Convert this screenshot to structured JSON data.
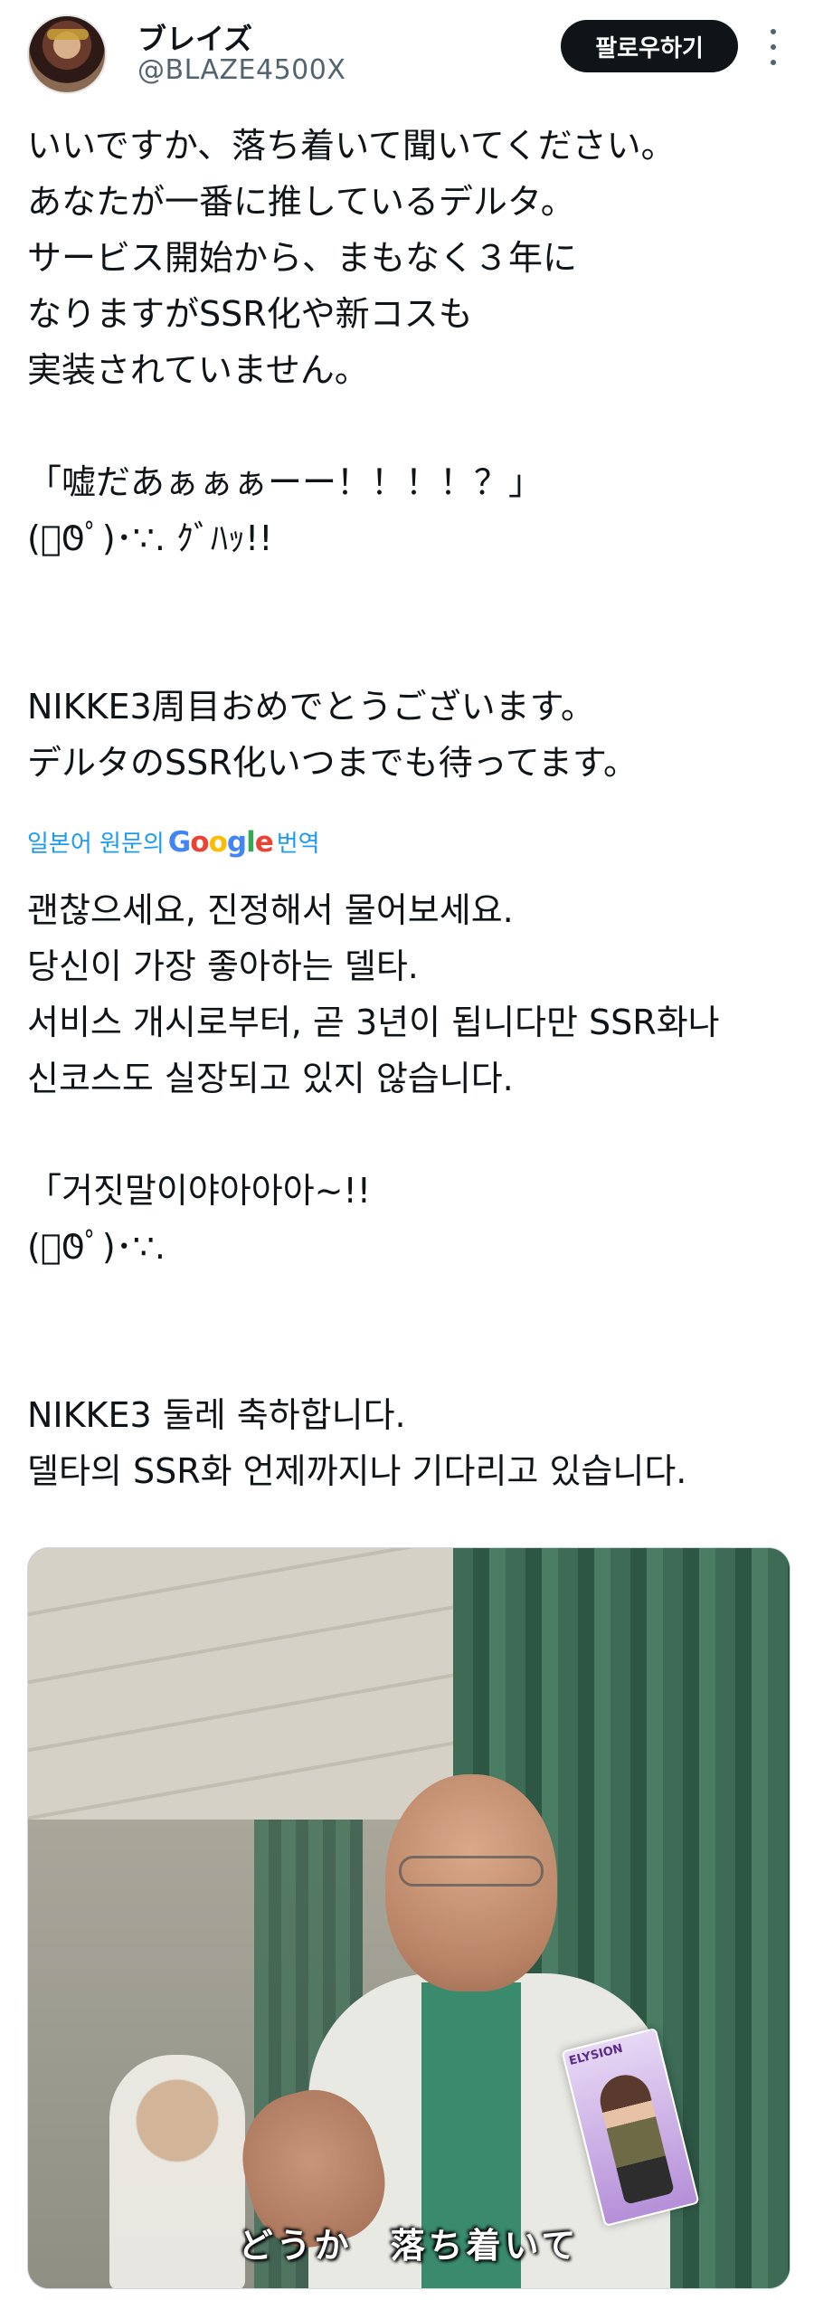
{
  "header": {
    "display_name": "ブレイズ",
    "handle": "@BLAZE4500X",
    "follow_label": "팔로우하기",
    "more_icon": "more-vertical-icon"
  },
  "tweet": {
    "lines": [
      "いいですか、落ち着いて聞いてください。",
      "あなたが一番に推しているデルタ。",
      "サービス開始から、まもなく３年に",
      "なりますがSSR化や新コスも",
      "実装されていません。",
      "",
      "「嘘だあぁぁぁーー！！！！？」",
      " (ﾟ𐐃ﾟ)･∵. ｸﾞﾊｯ!!",
      "",
      "",
      "NIKKE3周目おめでとうございます。",
      "デルタのSSR化いつまでも待ってます。"
    ]
  },
  "translate": {
    "prefix": "일본어 원문의",
    "brand": "Google",
    "suffix": "번역"
  },
  "translation": {
    "lines": [
      "괜찮으세요, 진정해서 물어보세요.",
      "당신이 가장 좋아하는 델타.",
      "서비스 개시로부터, 곧 3년이 됩니다만 SSR화나",
      "신코스도 실장되고 있지 않습니다.",
      "",
      "「거짓말이야아아아~!!",
      "(ﾟ𐐃ﾟ)･∵.",
      "",
      "",
      "NIKKE3 둘레 축하합니다.",
      "델타의 SSR화 언제까지나 기다리고 있습니다."
    ]
  },
  "media": {
    "subtitle": "どうか　落ち着いて",
    "card_label": "ELYSION"
  }
}
